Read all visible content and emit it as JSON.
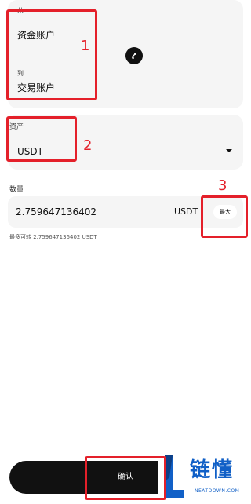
{
  "transfer": {
    "from_label": "从",
    "from_value": "资金账户",
    "to_label": "到",
    "to_value": "交易账户"
  },
  "asset": {
    "label": "资产",
    "value": "USDT"
  },
  "quantity": {
    "label": "数量",
    "value": "2.759647136402",
    "unit": "USDT",
    "max_label": "最大",
    "available_text": "最多可转 2.759647136402 USDT"
  },
  "actions": {
    "confirm_label": "确认"
  },
  "annotations": {
    "one": "1",
    "two": "2",
    "three": "3"
  },
  "watermark": {
    "text": "链懂",
    "sub": "NEATDOWN.COM"
  },
  "colors": {
    "annotation": "#e4202a",
    "watermark": "#1160c7",
    "field_bg": "#f5f5f5",
    "dark": "#111111"
  },
  "icons": {
    "swap": "swap-arrows-icon",
    "dropdown": "caret-down-icon",
    "logo": "neatdown-logo"
  }
}
